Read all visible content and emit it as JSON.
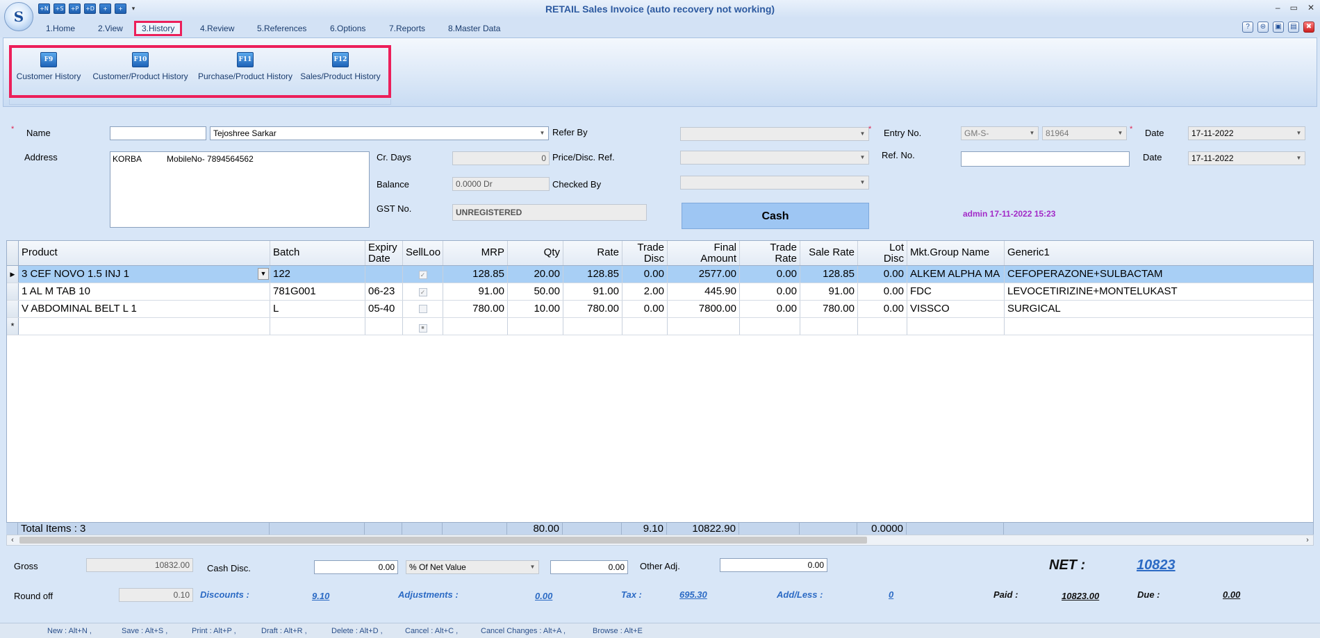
{
  "window": {
    "title": "RETAIL Sales Invoice (auto recovery not working)",
    "logo_letter": "S",
    "quick_access": [
      "+N",
      "+S",
      "+P",
      "+D",
      "+",
      "+"
    ],
    "controls": [
      "–",
      "▭",
      "✕"
    ]
  },
  "menu": {
    "tabs": [
      "1.Home",
      "2.View",
      "3.History",
      "4.Review",
      "5.References",
      "6.Options",
      "7.Reports",
      "8.Master Data"
    ],
    "active": "3.History",
    "right_icons": [
      "?",
      "⊜",
      "▣",
      "▤",
      "✖"
    ]
  },
  "ribbon": {
    "buttons": [
      {
        "key": "F9",
        "label": "Customer History"
      },
      {
        "key": "F10",
        "label": "Customer/Product History"
      },
      {
        "key": "F11",
        "label": "Purchase/Product History"
      },
      {
        "key": "F12",
        "label": "Sales/Product History"
      }
    ]
  },
  "form": {
    "name_label": "Name",
    "name_code": "",
    "name_value": "Tejoshree Sarkar",
    "address_label": "Address",
    "address_value": "KORBA           MobileNo- 7894564562",
    "cr_days_label": "Cr. Days",
    "cr_days_value": "0",
    "balance_label": "Balance",
    "balance_value": "0.0000 Dr",
    "gst_label": "GST No.",
    "gst_value": "UNREGISTERED",
    "refer_by_label": "Refer By",
    "price_disc_label": "Price/Disc. Ref.",
    "checked_by_label": "Checked By",
    "entry_no_label": "Entry No.",
    "entry_prefix": "GM-S-",
    "entry_number": "81964",
    "ref_no_label": "Ref. No.",
    "date_label": "Date",
    "date_value": "17-11-2022",
    "date2_label": "Date",
    "date2_value": "17-11-2022",
    "cash_button": "Cash",
    "admin_stamp": "admin 17-11-2022 15:23"
  },
  "grid": {
    "columns": [
      {
        "label": "Product"
      },
      {
        "label": "Batch"
      },
      {
        "label": "Expiry",
        "label2": "Date"
      },
      {
        "label": "SellLoo"
      },
      {
        "label": "MRP"
      },
      {
        "label": "Qty"
      },
      {
        "label": "Rate"
      },
      {
        "label": "Trade",
        "label2": "Disc"
      },
      {
        "label": "Final",
        "label2": "Amount"
      },
      {
        "label": "Trade",
        "label2": "Rate"
      },
      {
        "label": "Sale Rate"
      },
      {
        "label": "Lot",
        "label2": "Disc"
      },
      {
        "label": "Mkt.Group Name"
      },
      {
        "label": "Generic1"
      }
    ],
    "rows": [
      {
        "product": "3 CEF NOVO 1.5 INJ 1",
        "batch": "122",
        "expiry": "",
        "sell_loose": true,
        "mrp": "128.85",
        "qty": "20.00",
        "rate": "128.85",
        "trade_disc": "0.00",
        "final_amount": "2577.00",
        "trade_rate": "0.00",
        "sale_rate": "128.85",
        "lot_disc": "0.00",
        "mkt_group": "ALKEM ALPHA MA",
        "generic": "CEFOPERAZONE+SULBACTAM"
      },
      {
        "product": "1 AL M TAB 10",
        "batch": "781G001",
        "expiry": "06-23",
        "sell_loose": true,
        "mrp": "91.00",
        "qty": "50.00",
        "rate": "91.00",
        "trade_disc": "2.00",
        "final_amount": "445.90",
        "trade_rate": "0.00",
        "sale_rate": "91.00",
        "lot_disc": "0.00",
        "mkt_group": "FDC",
        "generic": "LEVOCETIRIZINE+MONTELUKAST"
      },
      {
        "product": "V ABDOMINAL BELT L 1",
        "batch": "L",
        "expiry": "05-40",
        "sell_loose": false,
        "mrp": "780.00",
        "qty": "10.00",
        "rate": "780.00",
        "trade_disc": "0.00",
        "final_amount": "7800.00",
        "trade_rate": "0.00",
        "sale_rate": "780.00",
        "lot_disc": "0.00",
        "mkt_group": "VISSCO",
        "generic": "SURGICAL"
      }
    ],
    "totals": {
      "label": "Total Items : 3",
      "qty": "80.00",
      "trade_disc": "9.10",
      "final_amount": "10822.90",
      "lot_disc": "0.0000"
    }
  },
  "summary": {
    "gross_label": "Gross",
    "gross_value": "10832.00",
    "cash_disc_label": "Cash Disc.",
    "cash_disc_value": "0.00",
    "cash_disc_mode": "% Of Net Value",
    "cash_disc_amount": "0.00",
    "other_adj_label": "Other Adj.",
    "other_adj_value": "0.00",
    "net_label": "NET :",
    "net_value": "10823",
    "round_off_label": "Round off",
    "round_off_value": "0.10",
    "discounts_label": "Discounts :",
    "discounts_value": "9.10",
    "adjustments_label": "Adjustments :",
    "adjustments_value": "0.00",
    "tax_label": "Tax :",
    "tax_value": "695.30",
    "addless_label": "Add/Less :",
    "addless_value": "0",
    "paid_label": "Paid :",
    "paid_value": "10823.00",
    "due_label": "Due :",
    "due_value": "0.00"
  },
  "shortcuts": [
    "New : Alt+N ,",
    "Save : Alt+S ,",
    "Print : Alt+P ,",
    "Draft : Alt+R ,",
    "Delete : Alt+D ,",
    "Cancel : Alt+C ,",
    "Cancel Changes : Alt+A ,",
    "Browse : Alt+E"
  ],
  "colors": {
    "accent": "#ec1f5a",
    "selection": "#a8cff5",
    "link": "#2b6ac4",
    "admin": "#a22ac7"
  }
}
